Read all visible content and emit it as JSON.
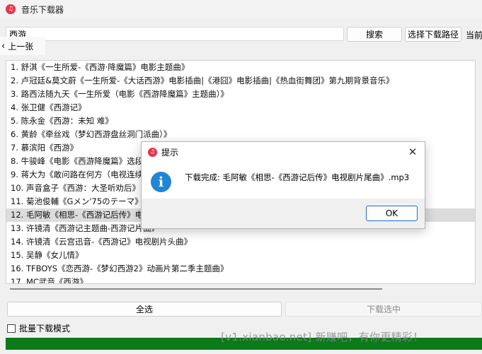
{
  "window": {
    "title": "音乐下载器",
    "app_icon": "music-note-icon",
    "accent": "#e8334a"
  },
  "search": {
    "value": "西游",
    "button_label": "搜索"
  },
  "choose_path_label": "选择下载路径",
  "current_path_label": "当前",
  "prev_page_label": "上一张",
  "results": [
    "1. 舒淇《一生所爱-《西游·降魔篇》电影主题曲》",
    "2. 卢冠廷&莫文蔚《一生所爱-《大话西游》电影插曲|《港囧》电影插曲|《热血街舞团》第九期背景音乐》",
    "3. 路西法随九天《一生所爱（电影《西游降魔篇》主题曲）》",
    "4. 张卫健《西游记》",
    "5. 陈永金《西游：未知          难》",
    "6. 黄龄《牵丝戏（梦幻西游盘丝洞门派曲）》",
    "7. 慕滨阳《西游》",
    "8. 牛骏峰《电影《西游降魔篇》选段》",
    "9. 蒋大为《敢问路在何方（电视连续剧《西游记》主题曲）》",
    "10. 声音盒子《西游：大圣听劝后》",
    "11. 菊池俊輔《Gメン'75のテーマ》",
    "12. 毛阿敏《相思-《西游记后传》电视剧片尾曲》",
    "13. 许镜清《西游记主题曲-西游记片曲》",
    "14. 许镜清《云宫迅音-《西游记》电视剧片头曲》",
    "15. 吴静《女儿情》",
    "16. TFBOYS《恋西游-《梦幻西游2》动画片第二季主题曲》",
    "17. MC武音《西游》"
  ],
  "selected_index": 11,
  "buttons": {
    "select_all": "全选",
    "download_selected": "下载选中"
  },
  "batch_mode": {
    "label": "批量下载模式",
    "checked": false
  },
  "progress": {
    "fraction": 1.0,
    "color": "#0a7a1a"
  },
  "watermark": "[v1.xianbao.net] 新赚吧，有你更精彩！",
  "dialog": {
    "title": "提示",
    "icon": "info-icon",
    "message": "下载完成: 毛阿敏《相思-《西游记后传》电视剧片尾曲》.mp3",
    "ok_label": "OK",
    "close_icon": "close-icon"
  }
}
